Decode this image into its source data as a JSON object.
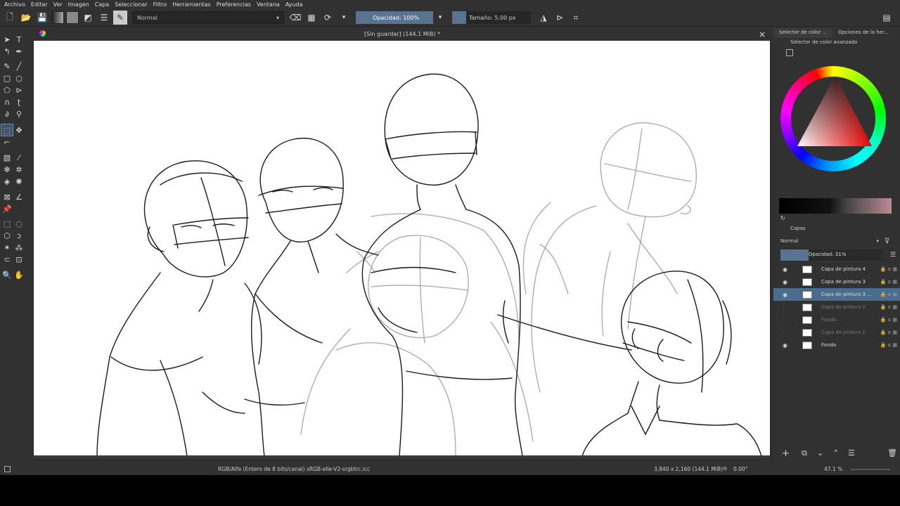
{
  "menu": [
    "Archivo",
    "Editar",
    "Ver",
    "Imagen",
    "Capa",
    "Seleccionar",
    "Filtro",
    "Herramientas",
    "Preferencias",
    "Ventana",
    "Ayuda"
  ],
  "toolbar": {
    "blend_mode": "Normal",
    "opacity_label": "Opacidad: 100%",
    "size_label": "Tamaño: 5.00 px"
  },
  "document": {
    "title": "[Sin guardar]  (144.1 MiB) *",
    "close_glyph": "×"
  },
  "docker": {
    "tabs": [
      "Selector de color ...",
      "Opciones de la her..."
    ],
    "color_panel_title": "Selector de color avanzado",
    "layers_title": "Capas",
    "layers_blend": "Normal",
    "layers_opacity": "Opacidad:  31%",
    "layers": [
      {
        "name": "Capa de pintura 4",
        "visible": true,
        "dim": false,
        "selected": false
      },
      {
        "name": "Capa de pintura 3",
        "visible": true,
        "dim": false,
        "selected": false
      },
      {
        "name": "Capa de pintura 3 ...",
        "visible": true,
        "dim": false,
        "selected": true
      },
      {
        "name": "Capa de pintura 2",
        "visible": false,
        "dim": true,
        "selected": false
      },
      {
        "name": "Fondo",
        "visible": false,
        "dim": true,
        "selected": false
      },
      {
        "name": "Capa de pintura 1",
        "visible": false,
        "dim": true,
        "selected": false
      },
      {
        "name": "Fondo",
        "visible": true,
        "dim": false,
        "selected": false
      }
    ]
  },
  "status": {
    "color_profile": "RGB/Alfa (Entero de 8 bits/canal)  sRGB-elle-V2-srgbtrc.icc",
    "dimensions": "3,840 x 2,160 (144.1 MiB)",
    "rotation": "0.00°",
    "zoom": "47.1 %"
  },
  "colors": {
    "accent": "#5a7391",
    "selected_layer": "#4a6c8e",
    "background": "#313131"
  }
}
